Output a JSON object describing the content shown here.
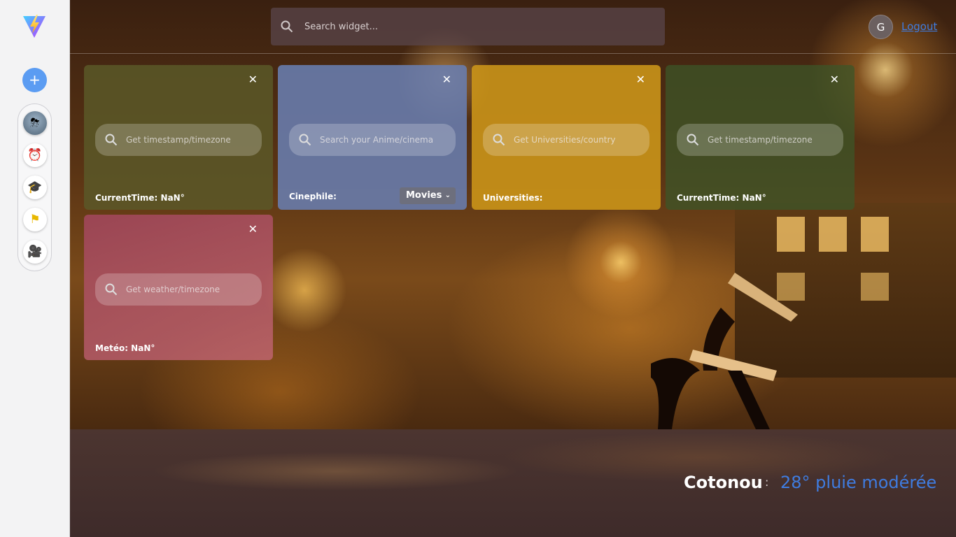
{
  "sidebar": {
    "add_label": "+",
    "apps": [
      {
        "name": "weather",
        "glyph": "⛈"
      },
      {
        "name": "alarm-clock",
        "glyph": "⏰"
      },
      {
        "name": "graduation-cap",
        "glyph": "🎓"
      },
      {
        "name": "flag",
        "glyph": "⚑"
      },
      {
        "name": "movie-camera",
        "glyph": "🎥"
      }
    ]
  },
  "header": {
    "search_placeholder": "Search widget...",
    "avatar_initial": "G",
    "logout_label": "Logout"
  },
  "widgets": [
    {
      "type": "time",
      "close": "✕",
      "placeholder": "Get timestamp/timezone",
      "label": "CurrentTime: NaN°"
    },
    {
      "type": "cinephile",
      "close": "✕",
      "placeholder": "Search your Anime/cinema",
      "label": "Cinephile:",
      "select_value": "Movies"
    },
    {
      "type": "universities",
      "close": "✕",
      "placeholder": "Get Universities/country",
      "label": "Universities:"
    },
    {
      "type": "time",
      "close": "✕",
      "placeholder": "Get timestamp/timezone",
      "label": "CurrentTime: NaN°"
    },
    {
      "type": "meteo",
      "close": "✕",
      "placeholder": "Get weather/timezone",
      "label": "Metéo: NaN°"
    }
  ],
  "footer": {
    "city": "Cotonou",
    "separator": ":",
    "weather": "28° pluie modérée"
  },
  "colors": {
    "accent": "#3f7ce0",
    "add_button": "#5b9cf2"
  }
}
